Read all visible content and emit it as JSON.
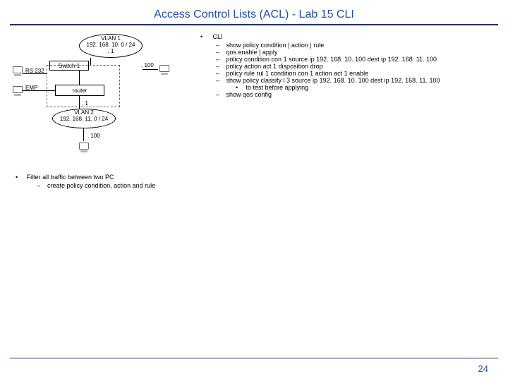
{
  "title": "Access Control Lists (ACL) - Lab 15 CLI",
  "page_number": "24",
  "diagram": {
    "vlan1_line1": "VLAN 1",
    "vlan1_line2": "192. 168. 10. 0 / 24",
    "vlan1_dot1": ". 1",
    "switch1": "Switch 1",
    "rs232": "RS 232",
    "emp": "EMP",
    "router": "router",
    "host100_top": ". 100",
    "vlan2_dot1": ". 1",
    "vlan2_line1": "VLAN 2",
    "vlan2_line2": "192. 168. 11. 0 / 24",
    "host100_bottom": ". 100"
  },
  "left_block": {
    "bullet": "•",
    "text": "Filter all traffic between two PC",
    "dash": "–",
    "subtext": "create policy condition, action and rule"
  },
  "cli": {
    "bullet": "•",
    "label": "CLI",
    "dash": "–",
    "subdot": "•",
    "items": [
      "show policy condition | action | rule",
      "qos enable | apply",
      "policy condition con 1 source ip 192. 168. 10. 100 dest ip 192. 168. 11. 100",
      "policy action act 1 disposition drop",
      "policy rule rul 1 condition con 1 action act 1 enable",
      "show policy classify l 3 source ip 192. 168. 10. 100 dest ip 192. 168. 11. 100"
    ],
    "subitem": "to test before applying",
    "last": "show qos config"
  }
}
